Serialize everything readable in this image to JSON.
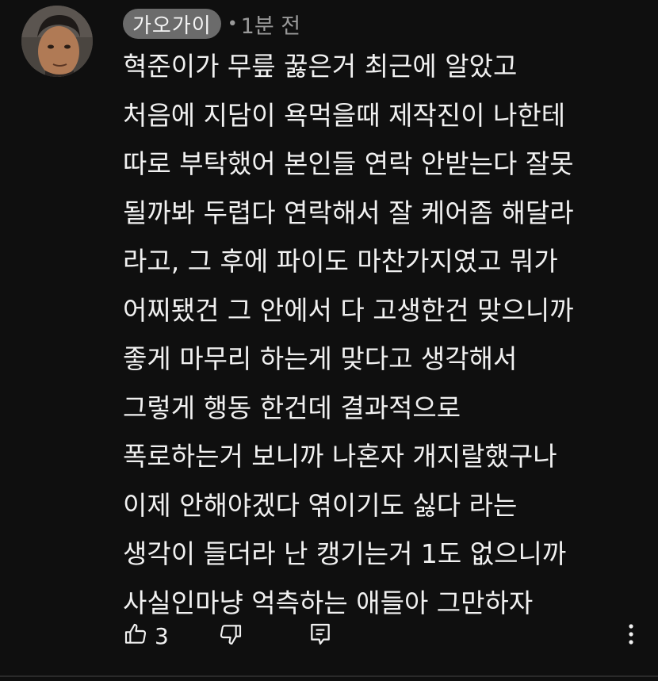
{
  "comment": {
    "author": "가오가이",
    "separator": "•",
    "time": "1분 전",
    "lines": [
      "혁준이가 무릎 꿇은거 최근에 알았고",
      "처음에 지담이 욕먹을때 제작진이 나한테",
      "따로 부탁했어 본인들 연락 안받는다 잘못",
      "될까봐 두렵다 연락해서 잘 케어좀 해달라",
      "라고, 그 후에 파이도 마찬가지였고 뭐가",
      "어찌됐건 그 안에서 다 고생한건 맞으니까",
      "좋게 마무리 하는게 맞다고 생각해서",
      "그렇게 행동 한건데 결과적으로",
      "폭로하는거 보니까 나혼자 개지랄했구나",
      "이제 안해야겠다 엮이기도 싫다 라는",
      "생각이 들더라 난 캥기는거 1도 없으니까",
      "사실인마냥 억측하는 애들아 그만하자"
    ],
    "likes": "3"
  },
  "icons": {
    "like": "thumbs-up-icon",
    "dislike": "thumbs-down-icon",
    "reply": "reply-icon",
    "more": "more-vert-icon"
  },
  "colors": {
    "background": "#0f0f0f",
    "text": "#f1f1f1",
    "author_chip": "#6b6b6b",
    "muted": "#9a9a9a"
  }
}
